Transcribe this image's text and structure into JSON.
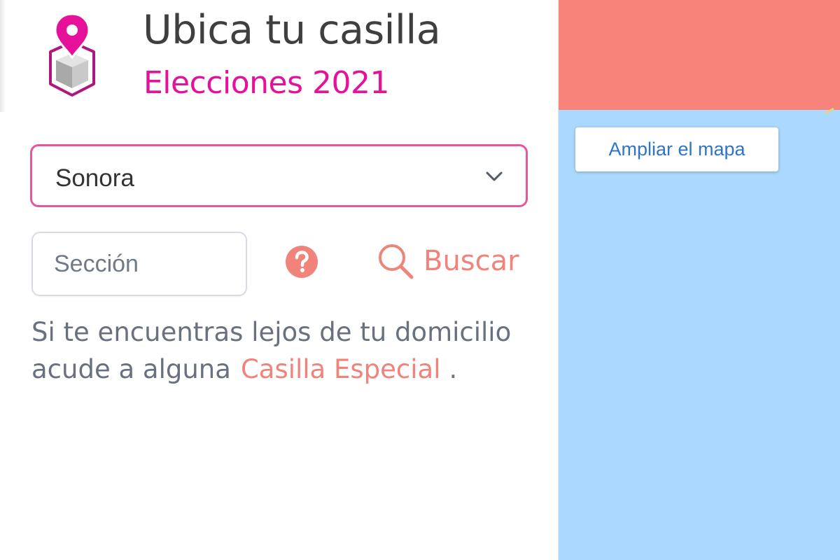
{
  "header": {
    "title": "Ubica tu casilla",
    "subtitle": "Elecciones 2021",
    "logo_icon": "ballot-box-location-pin-icon"
  },
  "form": {
    "state_select": {
      "selected": "Sonora",
      "icon": "chevron-down-icon"
    },
    "section_input": {
      "placeholder": "Sección",
      "value": ""
    },
    "help_icon": "question-circle-icon",
    "search_button": {
      "label": "Buscar",
      "icon": "search-icon"
    }
  },
  "info": {
    "text_before": "Si te encuentras lejos de tu domicilio acude a alguna",
    "link": "Casilla Especial",
    "text_after": "."
  },
  "map": {
    "expand_label": "Ampliar el mapa"
  },
  "colors": {
    "brand_magenta": "#e5119a",
    "accent_coral": "#f0837a",
    "select_border": "#e55798",
    "map_water": "#aad8fe",
    "map_land": "#f7837b",
    "link_blue": "#2f74c8"
  }
}
